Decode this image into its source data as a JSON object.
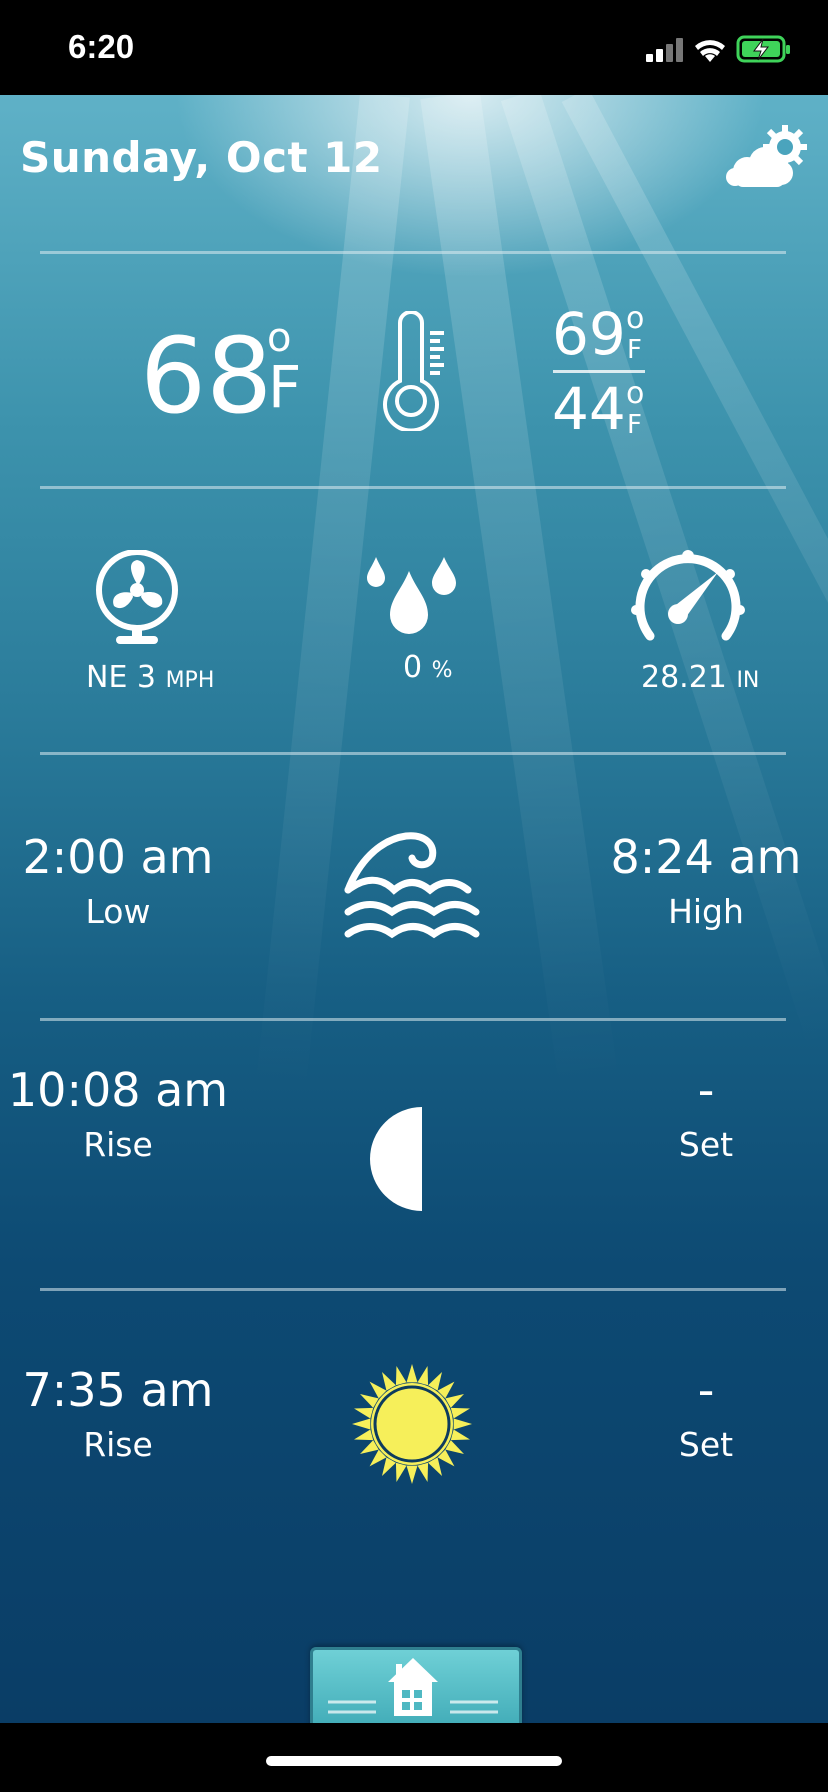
{
  "status_bar": {
    "time": "6:20"
  },
  "header": {
    "date": "Sunday, Oct 12"
  },
  "temperature": {
    "current": "68",
    "unit": "F",
    "degree_symbol": "o",
    "high": "69",
    "low": "44"
  },
  "conditions": {
    "wind_dir_speed": "NE 3",
    "wind_unit": "MPH",
    "precip_value": "0",
    "precip_unit": "%",
    "pressure_value": "28.21",
    "pressure_unit": "IN"
  },
  "tide": {
    "low_time": "2:00 am",
    "low_label": "Low",
    "high_time": "8:24 am",
    "high_label": "High"
  },
  "moon": {
    "rise_time": "10:08 am",
    "rise_label": "Rise",
    "set_time": "-",
    "set_label": "Set"
  },
  "sun": {
    "rise_time": "7:35 am",
    "rise_label": "Rise",
    "set_time": "-",
    "set_label": "Set"
  },
  "colors": {
    "sun_fill": "#f6ef5a",
    "home_button": "#4fb8c2"
  }
}
